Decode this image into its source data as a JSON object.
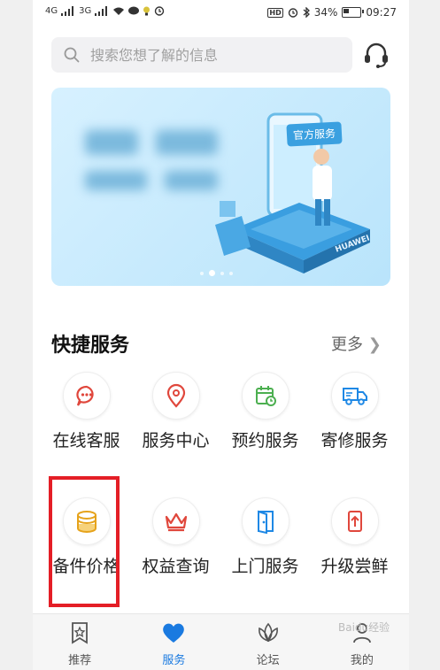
{
  "status_bar": {
    "carrier1": "4G",
    "carrier2": "3G",
    "battery": "34%",
    "time": "09:27"
  },
  "search": {
    "placeholder": "搜索您想了解的信息"
  },
  "banner": {
    "badge": "官方服务",
    "brand": "HUAWEI"
  },
  "quick_services": {
    "title": "快捷服务",
    "more": "更多",
    "items": [
      {
        "label": "在线客服",
        "icon": "chat-icon",
        "color": "#e0473c"
      },
      {
        "label": "服务中心",
        "icon": "location-icon",
        "color": "#e0473c"
      },
      {
        "label": "预约服务",
        "icon": "calendar-icon",
        "color": "#4caf50"
      },
      {
        "label": "寄修服务",
        "icon": "truck-icon",
        "color": "#1e88e5"
      },
      {
        "label": "备件价格",
        "icon": "coins-icon",
        "color": "#e6a31b"
      },
      {
        "label": "权益查询",
        "icon": "crown-icon",
        "color": "#e0473c"
      },
      {
        "label": "上门服务",
        "icon": "door-icon",
        "color": "#1e88e5"
      },
      {
        "label": "升级尝鲜",
        "icon": "upgrade-icon",
        "color": "#e0473c"
      }
    ]
  },
  "tabs": [
    {
      "label": "推荐",
      "icon": "bookmark-star-icon"
    },
    {
      "label": "服务",
      "icon": "heart-icon"
    },
    {
      "label": "论坛",
      "icon": "lotus-icon"
    },
    {
      "label": "我的",
      "icon": "user-icon"
    }
  ],
  "watermark": "Baidu经验"
}
